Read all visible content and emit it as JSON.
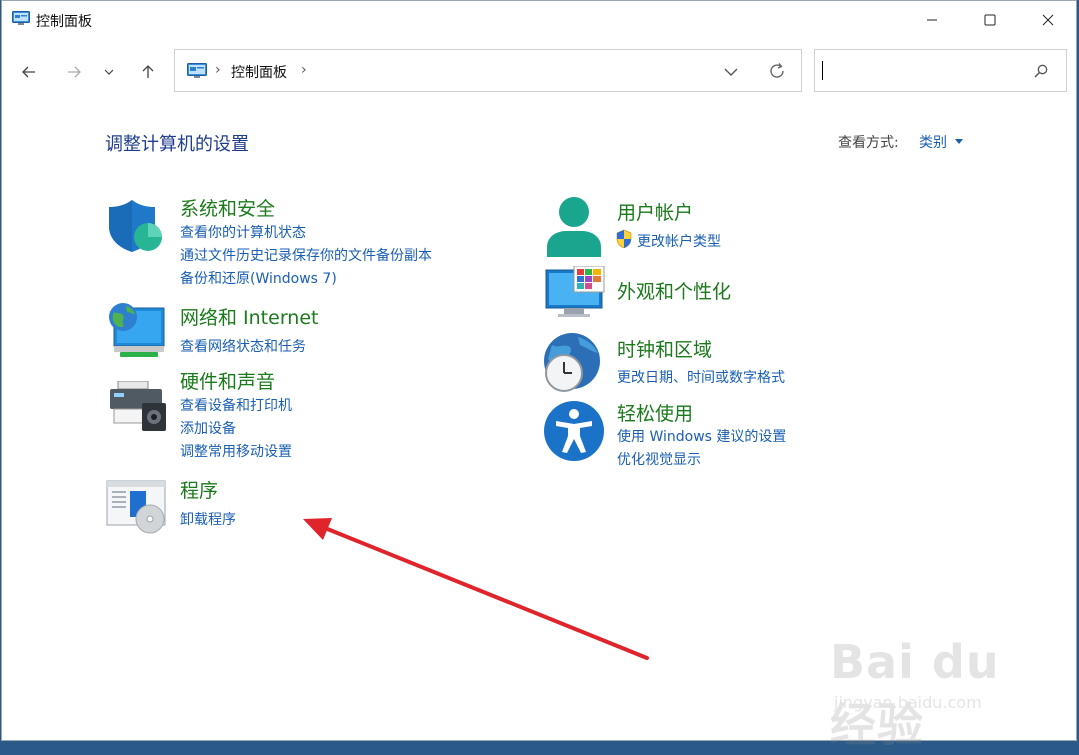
{
  "window": {
    "title": "控制面板"
  },
  "address": {
    "location": "控制面板",
    "separator": "›"
  },
  "search": {
    "placeholder": ""
  },
  "main": {
    "heading": "调整计算机的设置",
    "view_by_label": "查看方式:",
    "view_by_value": "类别"
  },
  "categories": {
    "security": {
      "title": "系统和安全",
      "links": [
        "查看你的计算机状态",
        "通过文件历史记录保存你的文件备份副本",
        "备份和还原(Windows 7)"
      ]
    },
    "network": {
      "title": "网络和 Internet",
      "links": [
        "查看网络状态和任务"
      ]
    },
    "hardware": {
      "title": "硬件和声音",
      "links": [
        "查看设备和打印机",
        "添加设备",
        "调整常用移动设置"
      ]
    },
    "programs": {
      "title": "程序",
      "links": [
        "卸载程序"
      ]
    },
    "user_accounts": {
      "title": "用户帐户",
      "links": [
        "更改帐户类型"
      ]
    },
    "appearance": {
      "title": "外观和个性化",
      "links": []
    },
    "clock": {
      "title": "时钟和区域",
      "links": [
        "更改日期、时间或数字格式"
      ]
    },
    "ease": {
      "title": "轻松使用",
      "links": [
        "使用 Windows 建议的设置",
        "优化视觉显示"
      ]
    }
  },
  "watermark": {
    "brand": "Bai du 经验",
    "url": "jingyan.baidu.com"
  },
  "colors": {
    "link": "#1a5fb4",
    "category": "#1b7a1b",
    "heading": "#1e3e8c",
    "arrow": "#e0242b"
  }
}
